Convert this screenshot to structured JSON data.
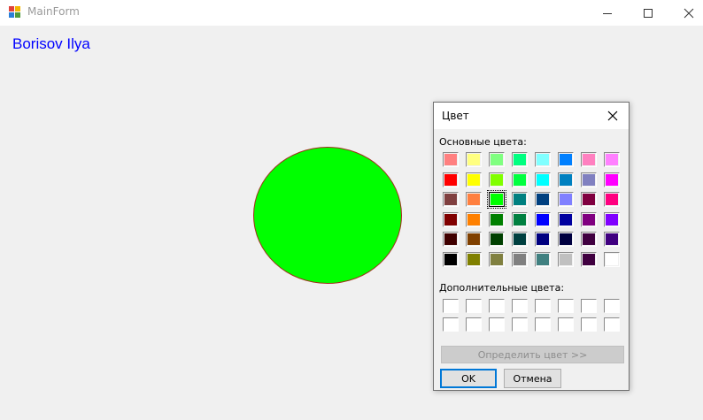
{
  "window": {
    "title": "MainForm",
    "app_icon": "windows-forms-app-icon",
    "controls": {
      "minimize": "minimize-icon",
      "maximize": "maximize-icon",
      "close": "close-icon"
    }
  },
  "main": {
    "author_label": "Borisov Ilya",
    "author_color": "#0000ff",
    "shape": {
      "kind": "ellipse",
      "fill": "#00ff00",
      "outline": "#a0301a"
    }
  },
  "color_dialog": {
    "title": "Цвет",
    "basic_colors_label": "Основные цвета:",
    "custom_colors_label": "Дополнительные цвета:",
    "basic_colors": [
      "#ff8080",
      "#ffff80",
      "#80ff80",
      "#00ff80",
      "#80ffff",
      "#0080ff",
      "#ff80c0",
      "#ff80ff",
      "#ff0000",
      "#ffff00",
      "#80ff00",
      "#00ff40",
      "#00ffff",
      "#0080c0",
      "#8080c0",
      "#ff00ff",
      "#804040",
      "#ff8040",
      "#00ff00",
      "#008080",
      "#004080",
      "#8080ff",
      "#800040",
      "#ff0080",
      "#800000",
      "#ff8000",
      "#008000",
      "#008040",
      "#0000ff",
      "#0000a0",
      "#800080",
      "#8000ff",
      "#400000",
      "#804000",
      "#004000",
      "#004040",
      "#000080",
      "#000040",
      "#400040",
      "#400080",
      "#000000",
      "#808000",
      "#808040",
      "#808080",
      "#408080",
      "#c0c0c0",
      "#400040",
      "#ffffff"
    ],
    "selected_index": 18,
    "custom_colors": [
      "#ffffff",
      "#ffffff",
      "#ffffff",
      "#ffffff",
      "#ffffff",
      "#ffffff",
      "#ffffff",
      "#ffffff",
      "#ffffff",
      "#ffffff",
      "#ffffff",
      "#ffffff",
      "#ffffff",
      "#ffffff",
      "#ffffff",
      "#ffffff"
    ],
    "define_custom_label": "Определить цвет >>",
    "ok_label": "OK",
    "cancel_label": "Отмена"
  }
}
